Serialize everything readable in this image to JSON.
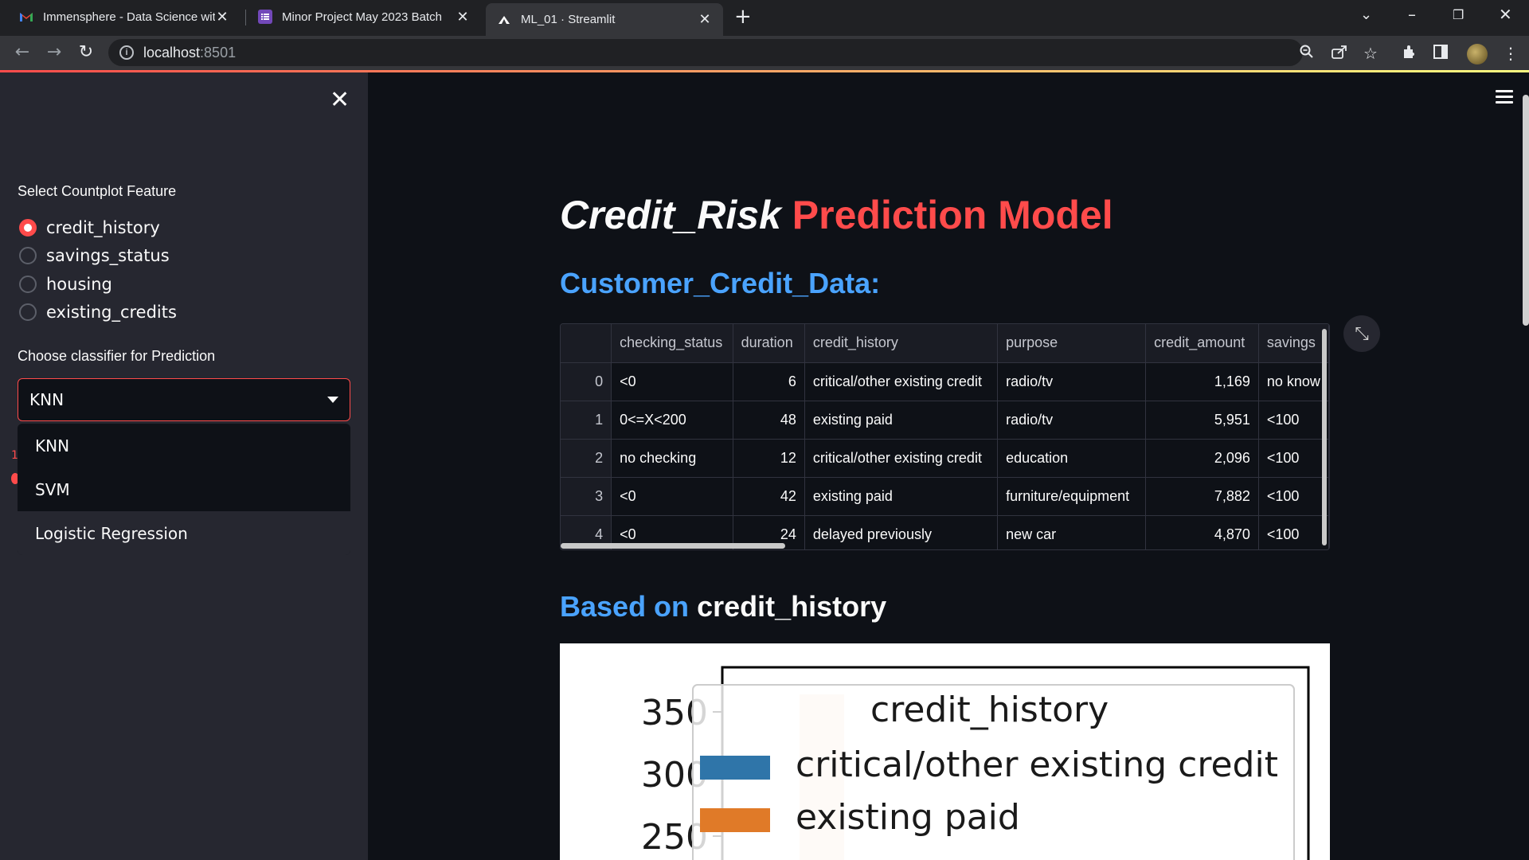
{
  "browser": {
    "tabs": [
      {
        "title": "Immensphere - Data Science wit",
        "icon": "gmail-icon"
      },
      {
        "title": "Minor Project May 2023 Batch",
        "icon": "forms-icon"
      },
      {
        "title": "ML_01 · Streamlit",
        "icon": "streamlit-icon"
      }
    ],
    "url_host": "localhost",
    "url_port": ":8501"
  },
  "sidebar": {
    "countplot_label": "Select Countplot Feature",
    "countplot_options": [
      "credit_history",
      "savings_status",
      "housing",
      "existing_credits"
    ],
    "countplot_selected": "credit_history",
    "classifier_label": "Choose classifier for Prediction",
    "classifier_selected": "KNN",
    "classifier_options": [
      "KNN",
      "SVM",
      "Logistic Regression"
    ]
  },
  "main": {
    "title_part1": "Credit_Risk",
    "title_part2": "Prediction Model",
    "subheader": "Customer_Credit_Data:",
    "table": {
      "columns": [
        "",
        "checking_status",
        "duration",
        "credit_history",
        "purpose",
        "credit_amount",
        "savings"
      ],
      "rows": [
        [
          "0",
          "<0",
          "6",
          "critical/other existing credit",
          "radio/tv",
          "1,169",
          "no know"
        ],
        [
          "1",
          "0<=X<200",
          "48",
          "existing paid",
          "radio/tv",
          "5,951",
          "<100"
        ],
        [
          "2",
          "no checking",
          "12",
          "critical/other existing credit",
          "education",
          "2,096",
          "<100"
        ],
        [
          "3",
          "<0",
          "42",
          "existing paid",
          "furniture/equipment",
          "7,882",
          "<100"
        ],
        [
          "4",
          "<0",
          "24",
          "delayed previously",
          "new car",
          "4,870",
          "<100"
        ]
      ]
    },
    "based_on_prefix": "Based on",
    "based_on_feature": "credit_history"
  },
  "chart_data": {
    "type": "bar",
    "title": "",
    "legend_title": "credit_history",
    "legend_entries": [
      "critical/other existing credit",
      "existing paid"
    ],
    "y_ticks": [
      "350",
      "300",
      "250"
    ],
    "colors": {
      "critical/other existing credit": "#2f75a9",
      "existing paid": "#e07a28"
    }
  }
}
